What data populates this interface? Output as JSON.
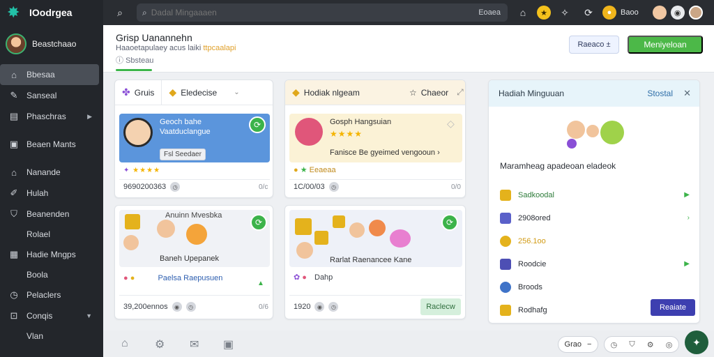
{
  "app": {
    "name": "IOodrgea"
  },
  "profile": {
    "name": "Beastchaao"
  },
  "sidebar": {
    "items": [
      {
        "label": "Bbesaa",
        "icon": "home-icon",
        "active": true
      },
      {
        "label": "Sanseal",
        "icon": "edit-icon"
      },
      {
        "label": "Phaschras",
        "icon": "storefront-icon",
        "caret": true
      },
      {
        "label": "Beaen Mants",
        "icon": "box-icon"
      },
      {
        "label": "Nanande",
        "icon": "house-icon"
      },
      {
        "label": "Hulah",
        "icon": "pen-icon"
      },
      {
        "label": "Beanenden",
        "icon": "shield-icon"
      },
      {
        "label": "Rolael",
        "icon": ""
      },
      {
        "label": "Hadie Mngps",
        "icon": "grid-icon"
      },
      {
        "label": "Boola",
        "icon": ""
      },
      {
        "label": "Pelaclers",
        "icon": "clock-icon"
      },
      {
        "label": "Conqis",
        "icon": "cart-icon",
        "caret": true
      },
      {
        "label": "Vlan",
        "icon": ""
      }
    ]
  },
  "topbar": {
    "search_placeholder": "Dadal Mingaaaen",
    "search_kbd": "Eoaea",
    "user_label": "Baoo"
  },
  "header": {
    "title": "Grisp Uanannehn",
    "subtitle_pre": "Haaoetapulaey acus laiki",
    "subtitle_hl": "ttpcaalapi",
    "meta": "Sbsteau",
    "btn_outline": "Raeaco ±",
    "btn_green": "Meniyeloan"
  },
  "card1": {
    "tab1": "Gruis",
    "tab2": "Eledecise",
    "panel_title": "Geoch bahe",
    "panel_sub": "Vaatduclangue",
    "chip": "Fsl Seedaer",
    "stars": "★★★★",
    "footer_left": "9690200363",
    "footer_right": "0/ᴄ"
  },
  "card2": {
    "tab": "Hodiak nlgeam",
    "tab_action": "Chaeor",
    "panel_title": "Gosph Hangsuian",
    "stars": "★★★★",
    "desc": "Fanisce Be gyeimed vengooun ›",
    "label": "Eeaeaa",
    "footer_left": "1C/00/03",
    "footer_right": "0/0"
  },
  "card3": {
    "panel_title": "Anuinn Mvesbka",
    "caption": "Baneh Upepanek",
    "link": "Paelsa Raepusuen",
    "footer_left": "39,200ennos",
    "footer_right": "0/6"
  },
  "card4": {
    "caption": "Rarlat Raenancee Kane",
    "sub": "Dahp",
    "footer_left": "1920",
    "button": "Raclecw"
  },
  "right_card": {
    "title": "Hadiah Minguuan",
    "action": "Stostal",
    "desc": "Maramheag apadeoan eladeok",
    "items": [
      {
        "label": "Sadkoodal",
        "color": "#e4b21c",
        "accent": true
      },
      {
        "label": "2908ored",
        "color": "#5a60c9"
      },
      {
        "label": "256.1oo",
        "color": "#e4b21c",
        "gold": true
      },
      {
        "label": "Roodcie",
        "color": "#4d4fb4"
      },
      {
        "label": "Broods",
        "color": "#3f73c8"
      },
      {
        "label": "Rodhafg",
        "color": "#e4b21c"
      }
    ],
    "button": "Reaiate"
  },
  "bottombar": {
    "pill_label": "Grao"
  },
  "colors": {
    "accent_green": "#4cb848",
    "sidebar_bg": "#23262b",
    "indigo": "#3d3fb0"
  }
}
